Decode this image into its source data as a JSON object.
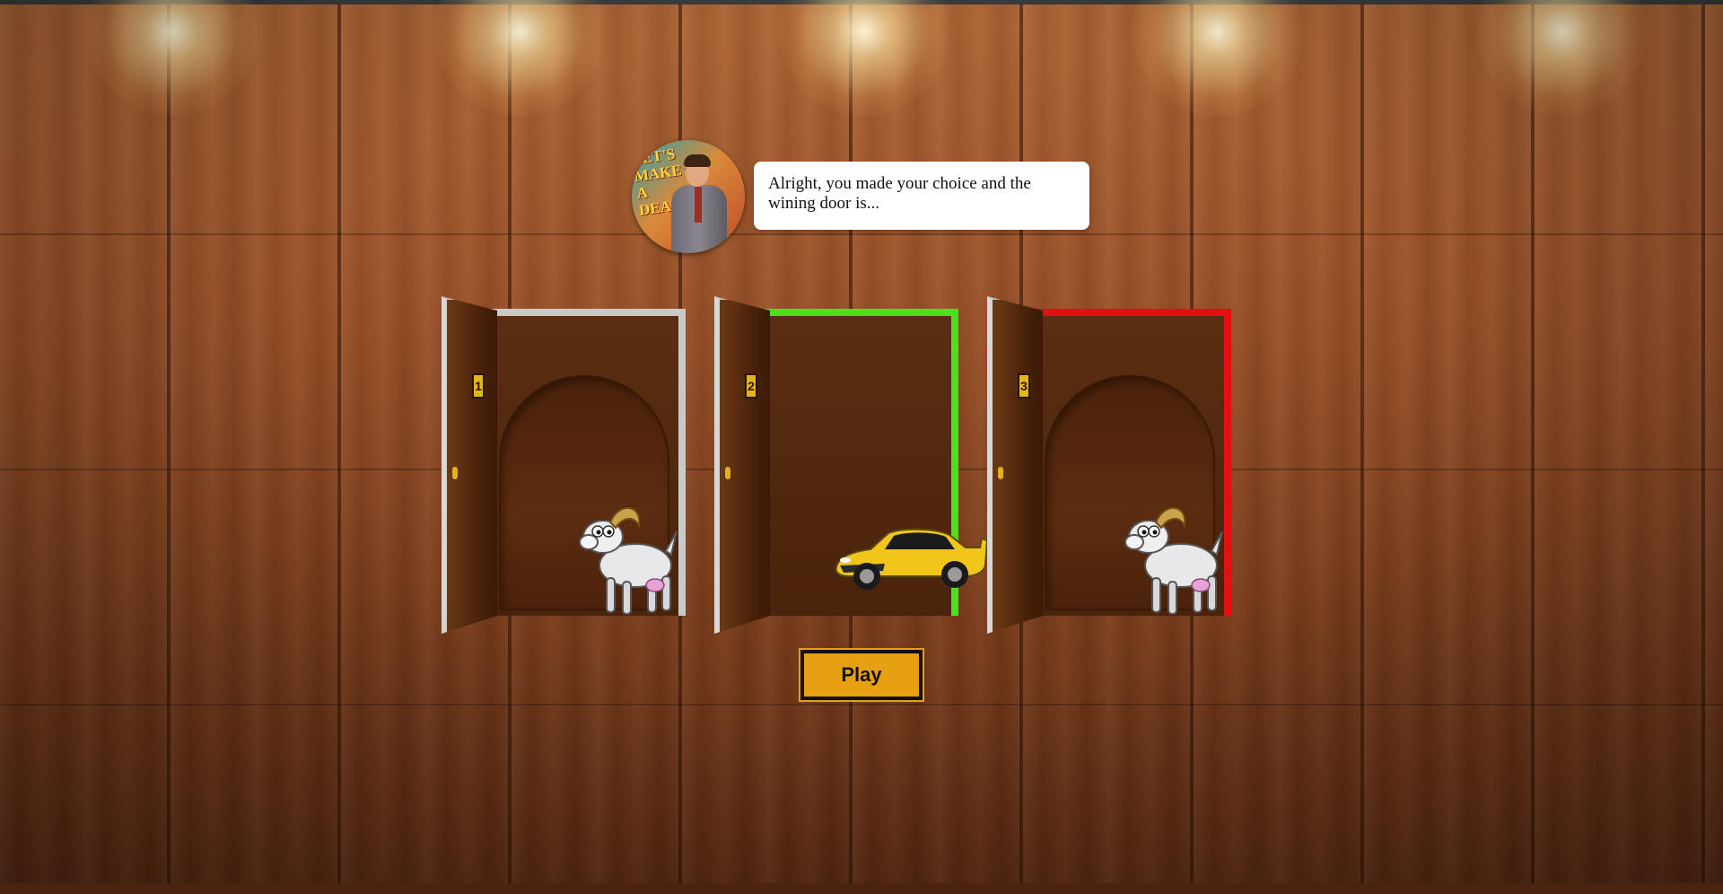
{
  "host": {
    "sign_text": "LET'S MAKE A DEAL",
    "speech": "Alright, you made your choice and the wining door is..."
  },
  "doors": [
    {
      "number": "1",
      "prize": "goat",
      "frame_color": "#c9c9c9"
    },
    {
      "number": "2",
      "prize": "car",
      "frame_color": "#4ee01a"
    },
    {
      "number": "3",
      "prize": "goat",
      "frame_color": "#e41010"
    }
  ],
  "play_button": {
    "label": "Play"
  },
  "colors": {
    "button_bg": "#e7a012",
    "selected": "#e41010",
    "winner": "#4ee01a"
  }
}
